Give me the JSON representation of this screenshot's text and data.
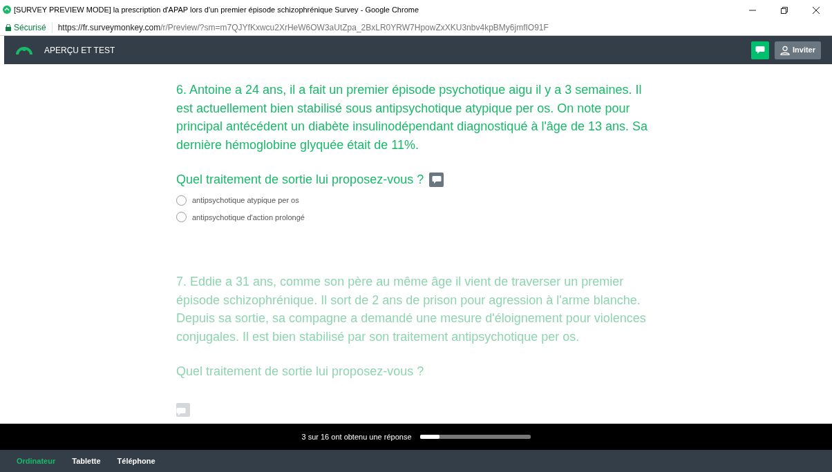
{
  "window": {
    "title": "[SURVEY PREVIEW MODE] la prescription d'APAP lors d'un premier épisode schizophrénique Survey - Google Chrome"
  },
  "address_bar": {
    "security": "Sécurisé",
    "url_host": "https://fr.surveymonkey.com",
    "url_path": "/r/Preview/?sm=m7QJYfKxwcu2XrHeW6OW3aUtZpa_2BxLR0YRW7HpowZxXKU3nbv4kpBMy6jmfIO91F"
  },
  "header": {
    "title": "APERÇU ET TEST",
    "invite_button": "Inviter"
  },
  "questions": [
    {
      "kind": "active",
      "text": "6. Antoine a 24 ans, il a fait un premier épisode psychotique aigu il y a 3 semaines. Il est actuellement bien stabilisé sous antipsychotique atypique per os. On note pour principal antécédent un diabète insulinodépendant diagnostiqué à l'âge de 13 ans. Sa dernière hémoglobine glyquée était de 11%.",
      "prompt": "Quel traitement de sortie lui proposez-vous ?",
      "options": [
        {
          "label": "antipsychotique atypique per os",
          "selected": false
        },
        {
          "label": "antipsychotique d'action prolongé",
          "selected": false
        }
      ]
    },
    {
      "kind": "faded",
      "text": "7. Eddie a 31 ans, comme son père au même âge il vient de traverser un premier épisode schizophrénique. Il sort de 2 ans de prison pour agression à l'arme blanche. Depuis sa sortie, sa compagne a demandé une mesure d'éloignement pour violences conjugales. Il est bien stabilisé par son traitement antipsychotique per os.",
      "prompt": "Quel traitement de sortie lui proposez-vous ?"
    }
  ],
  "progress": {
    "text": "3 sur 16 ont obtenu une réponse",
    "level": 0.18
  },
  "device_tabs": [
    {
      "label": "Ordinateur",
      "selected": true
    },
    {
      "label": "Tablette",
      "selected": false
    },
    {
      "label": "Téléphone",
      "selected": false
    }
  ]
}
